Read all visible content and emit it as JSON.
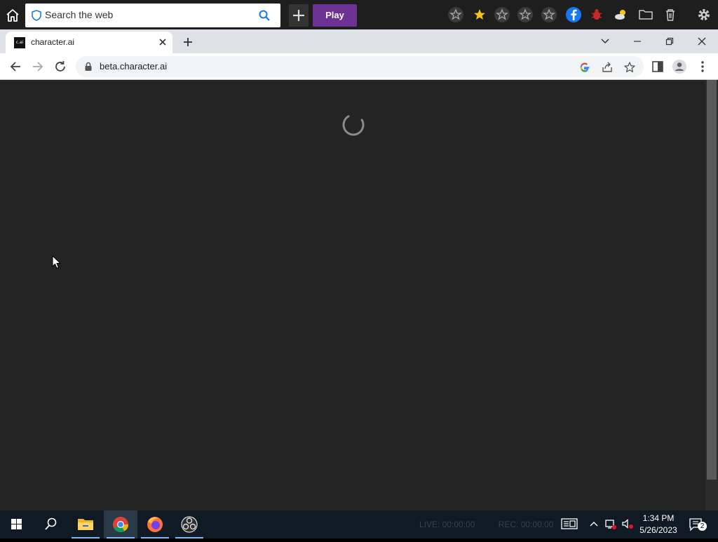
{
  "topbar": {
    "search_placeholder": "Search the web",
    "play_label": "Play"
  },
  "browser": {
    "tab_title": "character.ai",
    "tab_favicon_text": "c.ai",
    "url": "beta.character.ai"
  },
  "obs": {
    "live_label": "LIVE: 00:00:00",
    "rec_label": "REC: 00:00:00"
  },
  "taskbar": {
    "time": "1:34 PM",
    "date": "5/26/2023",
    "notification_count": "2"
  },
  "colors": {
    "page_background": "#242424",
    "play_button": "#6b3294",
    "taskbar": "#0f1a24"
  }
}
